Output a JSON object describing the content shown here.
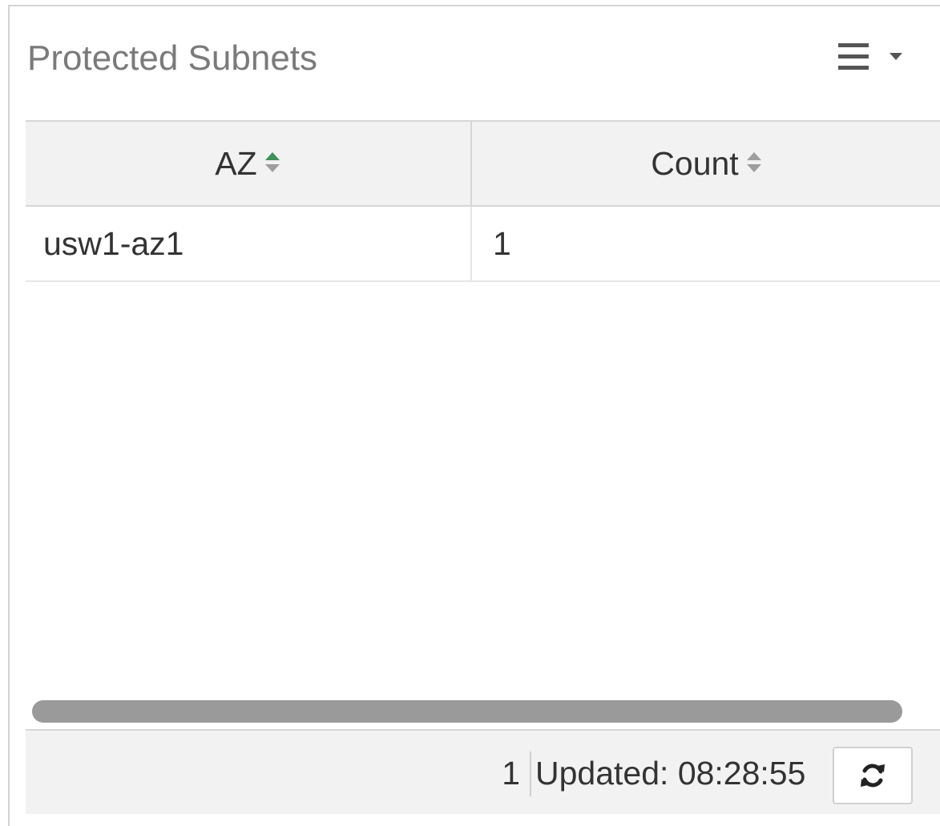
{
  "widget": {
    "title": "Protected Subnets",
    "menu_icon": "hamburger-menu-icon",
    "menu_caret_icon": "caret-down-icon"
  },
  "table": {
    "columns": [
      {
        "label": "AZ",
        "sort": "ascending",
        "sort_icon": "sort-icon"
      },
      {
        "label": "Count",
        "sort": "none",
        "sort_icon": "sort-icon"
      }
    ],
    "rows": [
      {
        "az": "usw1-az1",
        "count": "1"
      }
    ]
  },
  "footer": {
    "count": "1",
    "updated_label": "Updated:",
    "updated_time": "08:28:55",
    "refresh_icon": "refresh-icon"
  },
  "colors": {
    "sort_active": "#3f8f5a",
    "sort_inactive": "#9e9e9e",
    "title": "#7a7a7a"
  }
}
